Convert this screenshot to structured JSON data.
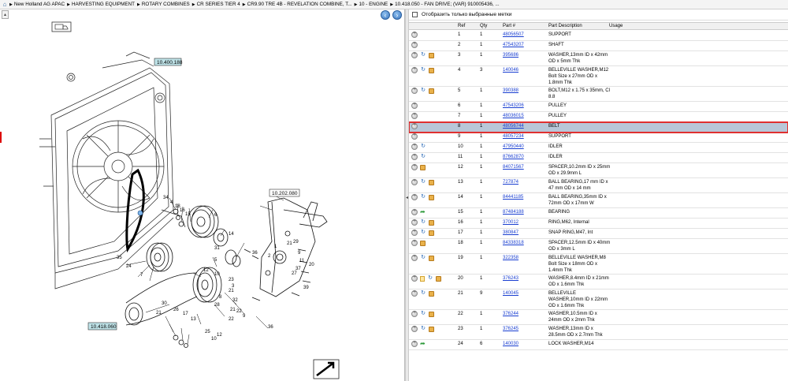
{
  "breadcrumb": {
    "home_icon": "home-icon",
    "items": [
      "New Holland AG APAC",
      "HARVESTING EQUIPMENT",
      "ROTARY COMBINES",
      "CR SERIES TIER 4",
      "CR9.90 TRE 4B - REVELATION COMBINE, T...",
      "10 - ENGINE",
      "10.418.050 - FAN DRIVE; (VAR) 910005436, ..."
    ]
  },
  "diagram": {
    "callouts": [
      "10.400.188",
      "10.202.080",
      "10.418.060"
    ],
    "part_numbers": [
      "34",
      "4",
      "18",
      "16",
      "15",
      "6",
      "14",
      "1",
      "29",
      "36",
      "21",
      "2",
      "9",
      "11",
      "37",
      "27",
      "20",
      "39",
      "31",
      "5",
      "23",
      "3",
      "35",
      "24",
      "7",
      "12",
      "10",
      "21",
      "8",
      "32",
      "28",
      "21",
      "22",
      "36",
      "30",
      "26",
      "17",
      "13",
      "21",
      "25",
      "10",
      "12",
      "22",
      "9"
    ]
  },
  "filter": {
    "label": "Отобразить только выбранные метки"
  },
  "grid": {
    "headers": {
      "ref": "Ref",
      "qty": "Qty",
      "part": "Part #",
      "desc": "Part Description",
      "usage": "Usage"
    },
    "rows": [
      {
        "ref": "1",
        "qty": "1",
        "part": "48056507",
        "desc": "SUPPORT",
        "icons": [
          "plus"
        ]
      },
      {
        "ref": "2",
        "qty": "1",
        "part": "47543207",
        "desc": "SHAFT",
        "icons": [
          "plus"
        ]
      },
      {
        "ref": "3",
        "qty": "1",
        "part": "395686",
        "desc": "WASHER,13mm ID x 42mm OD x 5mm Thk",
        "icons": [
          "plus",
          "arrow",
          "box"
        ]
      },
      {
        "ref": "4",
        "qty": "3",
        "part": "140046",
        "desc": "BELLEVILLE WASHER,M12 Bolt Size x 27mm OD x 1.8mm Thk",
        "icons": [
          "plus",
          "arrow",
          "box"
        ]
      },
      {
        "ref": "5",
        "qty": "1",
        "part": "390388",
        "desc": "BOLT,M12 x 1.75 x 35mm, Cl 8.8",
        "icons": [
          "plus",
          "arrow",
          "box"
        ]
      },
      {
        "ref": "6",
        "qty": "1",
        "part": "47543206",
        "desc": "PULLEY",
        "icons": [
          "plus"
        ]
      },
      {
        "ref": "7",
        "qty": "1",
        "part": "48036015",
        "desc": "PULLEY",
        "icons": [
          "plus"
        ]
      },
      {
        "ref": "8",
        "qty": "1",
        "part": "48056744",
        "desc": "BELT",
        "icons": [
          "plus"
        ],
        "selected": true
      },
      {
        "ref": "9",
        "qty": "1",
        "part": "48057234",
        "desc": "SUPPORT",
        "icons": [
          "plus"
        ]
      },
      {
        "ref": "10",
        "qty": "1",
        "part": "47950440",
        "desc": "IDLER",
        "icons": [
          "plus",
          "arrow"
        ]
      },
      {
        "ref": "11",
        "qty": "1",
        "part": "87662870",
        "desc": "IDLER",
        "icons": [
          "plus",
          "arrow"
        ]
      },
      {
        "ref": "12",
        "qty": "1",
        "part": "84071567",
        "desc": "SPACER,10.2mm ID x 25mm OD x 29.9mm L",
        "icons": [
          "plus",
          "box"
        ]
      },
      {
        "ref": "13",
        "qty": "1",
        "part": "727874",
        "desc": "BALL BEARING,17 mm ID x 47 mm OD x 14 mm",
        "icons": [
          "plus",
          "arrow",
          "box"
        ]
      },
      {
        "ref": "14",
        "qty": "1",
        "part": "84441185",
        "desc": "BALL BEARING,35mm ID x 72mm OD x 17mm W",
        "icons": [
          "plus",
          "arrow",
          "box"
        ]
      },
      {
        "ref": "15",
        "qty": "1",
        "part": "87484188",
        "desc": "BEARING",
        "icons": [
          "plus",
          "green"
        ]
      },
      {
        "ref": "16",
        "qty": "1",
        "part": "370012",
        "desc": "RING,M62, Internal",
        "icons": [
          "plus",
          "arrow",
          "box"
        ]
      },
      {
        "ref": "17",
        "qty": "1",
        "part": "380847",
        "desc": "SNAP RING,M47, Int",
        "icons": [
          "plus",
          "arrow",
          "box"
        ]
      },
      {
        "ref": "18",
        "qty": "1",
        "part": "84338318",
        "desc": "SPACER,12.5mm ID x 40mm OD x 3mm L",
        "icons": [
          "plus",
          "box"
        ]
      },
      {
        "ref": "19",
        "qty": "1",
        "part": "322358",
        "desc": "BELLEVILLE WASHER,M8 Bolt Size x 18mm OD x 1.4mm Thk",
        "icons": [
          "plus",
          "arrow",
          "box"
        ]
      },
      {
        "ref": "20",
        "qty": "1",
        "part": "376243",
        "desc": "WASHER,8.4mm ID x 21mm OD x 1.6mm Thk",
        "icons": [
          "plus",
          "note",
          "arrow",
          "box"
        ]
      },
      {
        "ref": "21",
        "qty": "9",
        "part": "140045",
        "desc": "BELLEVILLE WASHER,10mm ID x 22mm OD x 1.6mm Thk",
        "icons": [
          "plus",
          "arrow",
          "box"
        ]
      },
      {
        "ref": "22",
        "qty": "1",
        "part": "376244",
        "desc": "WASHER,10.5mm ID x 24mm OD x 2mm Thk",
        "icons": [
          "plus",
          "arrow",
          "box"
        ]
      },
      {
        "ref": "23",
        "qty": "1",
        "part": "376245",
        "desc": "WASHER,13mm ID x 28.5mm OD x 2.7mm Thk",
        "icons": [
          "plus",
          "arrow",
          "box"
        ]
      },
      {
        "ref": "24",
        "qty": "6",
        "part": "140030",
        "desc": "LOCK WASHER,M14",
        "icons": [
          "plus",
          "green"
        ]
      }
    ]
  },
  "colors": {
    "link": "#1a3fd1",
    "selected_row": "#b8c7d8",
    "selection_border": "#e03030",
    "callout_bg": "#bfe3e8"
  }
}
